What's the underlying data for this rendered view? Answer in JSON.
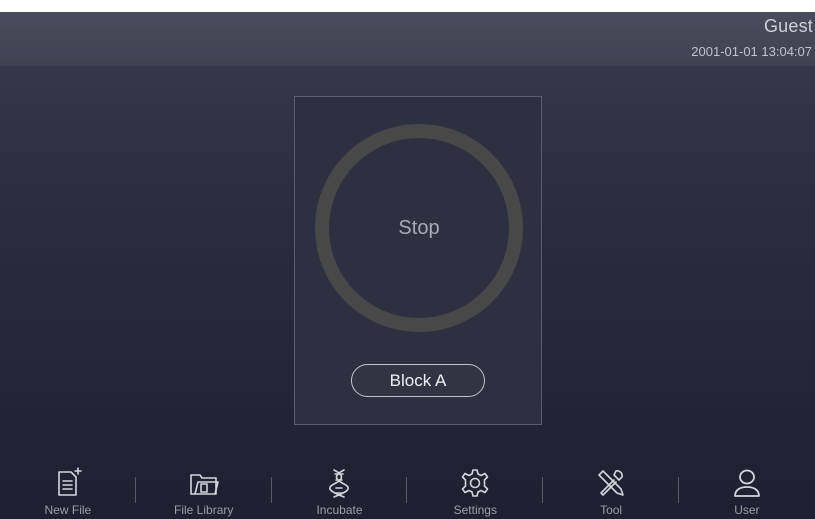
{
  "header": {
    "user": "Guest",
    "datetime": "2001-01-01 13:04:07"
  },
  "block": {
    "status": "Stop",
    "button_label": "Block A"
  },
  "nav": {
    "items": [
      {
        "label": "New File",
        "icon": "new-file-icon"
      },
      {
        "label": "File Library",
        "icon": "folder-icon"
      },
      {
        "label": "Incubate",
        "icon": "dna-icon"
      },
      {
        "label": "Settings",
        "icon": "gear-icon"
      },
      {
        "label": "Tool",
        "icon": "tools-icon"
      },
      {
        "label": "User",
        "icon": "user-icon"
      }
    ]
  },
  "colors": {
    "background_top": "#3a3c4e",
    "background_bottom": "#1e2032",
    "ring": "#484848",
    "icon_stroke": "#d4d5dc"
  }
}
